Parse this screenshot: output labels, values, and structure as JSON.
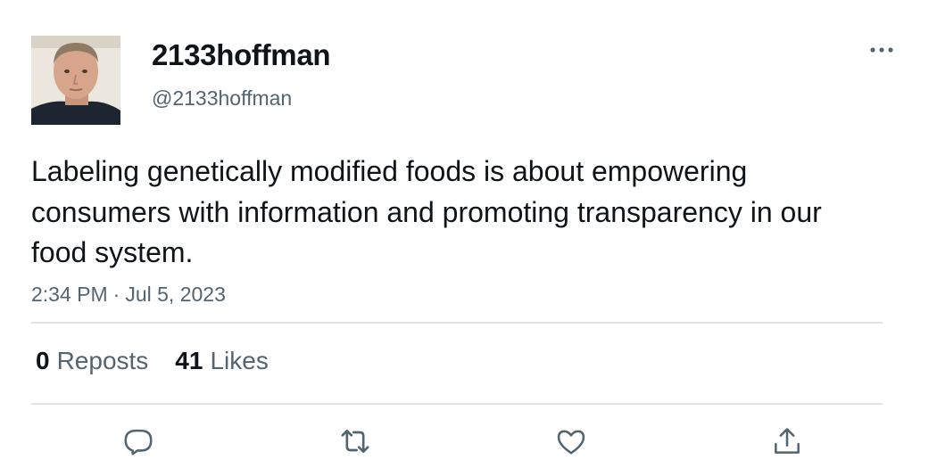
{
  "author": {
    "display_name": "2133hoffman",
    "handle": "@2133hoffman",
    "avatar_icon": "user-photo"
  },
  "tweet": {
    "text": "Labeling genetically modified foods is about empowering consumers with information and promoting transparency in our food system.",
    "time": "2:34 PM",
    "separator": "·",
    "date": "Jul 5, 2023"
  },
  "stats": {
    "reposts_count": "0",
    "reposts_label": "Reposts",
    "likes_count": "41",
    "likes_label": "Likes"
  },
  "actions": {
    "reply_icon": "reply-icon",
    "repost_icon": "repost-icon",
    "like_icon": "heart-icon",
    "share_icon": "share-icon"
  },
  "colors": {
    "text_primary": "#0f1419",
    "text_secondary": "#536471",
    "divider": "#e1e4e6"
  }
}
